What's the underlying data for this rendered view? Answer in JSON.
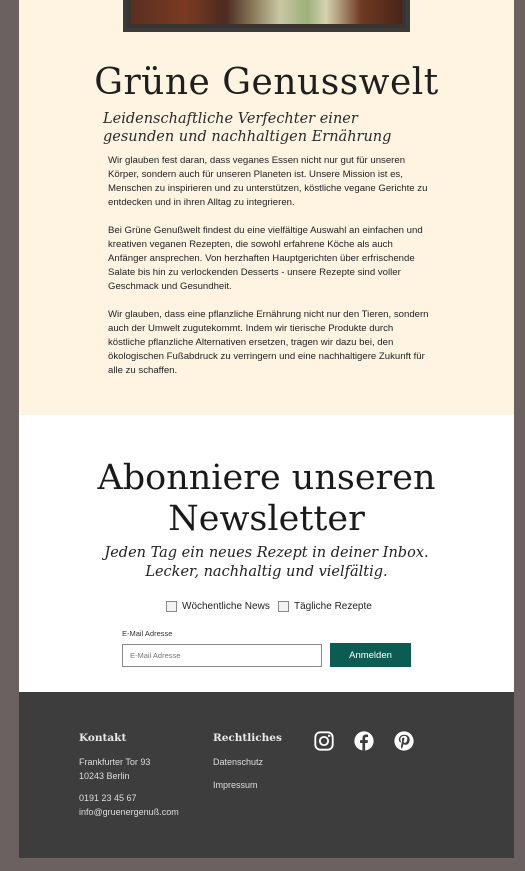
{
  "about": {
    "title": "Grüne Genusswelt",
    "subtitle": "Leidenschaftliche Verfechter einer gesunden und nachhaltigen Ernährung",
    "paragraphs": [
      "Wir glauben fest daran, dass veganes Essen nicht nur gut für unseren Körper, sondern auch für unseren Planeten ist. Unsere Mission ist es, Menschen zu inspirieren und zu unterstützen, köstliche vegane Gerichte zu entdecken und in ihren Alltag zu integrieren.",
      "Bei Grüne Genußwelt findest du eine vielfältige Auswahl an einfachen und kreativen veganen Rezepten, die sowohl erfahrene Köche als auch Anfänger ansprechen. Von herzhaften Hauptgerichten über erfrischende Salate bis hin zu verlockenden Desserts - unsere Rezepte sind voller Geschmack und Gesundheit.",
      "Wir glauben, dass eine pflanzliche Ernährung nicht nur den Tieren, sondern auch der Umwelt zugutekommt. Indem wir tierische Produkte durch köstliche pflanzliche Alternativen ersetzen, tragen wir dazu bei, den ökologischen Fußabdruck zu verringern und eine nachhaltigere Zukunft für alle zu schaffen."
    ]
  },
  "newsletter": {
    "title": "Abonniere unseren Newsletter",
    "tagline": "Jeden Tag ein neues Rezept in deiner Inbox. Lecker, nachhaltig und vielfältig.",
    "checkboxes": [
      {
        "label": "Wöchentliche News",
        "checked": false
      },
      {
        "label": "Tägliche Rezepte",
        "checked": false
      }
    ],
    "email_label": "E-Mail Adresse",
    "email_placeholder": "E-Mail Adresse",
    "email_value": "",
    "submit_label": "Anmelden"
  },
  "footer": {
    "contact_title": "Kontakt",
    "address_line1": "Frankfurter Tor 93",
    "address_line2": "10243 Berlin",
    "phone": "0191 23 45 67",
    "email": "info@gruenergenuß.com",
    "legal_title": "Rechtliches",
    "legal_links": [
      "Datenschutz",
      "Impressum"
    ],
    "social_icons": [
      "instagram-icon",
      "facebook-icon",
      "pinterest-icon"
    ]
  },
  "colors": {
    "page_bg": "#6b6161",
    "about_bg": "#fff4e2",
    "button": "#0d5c52",
    "footer_bg": "#3d3d3d"
  }
}
